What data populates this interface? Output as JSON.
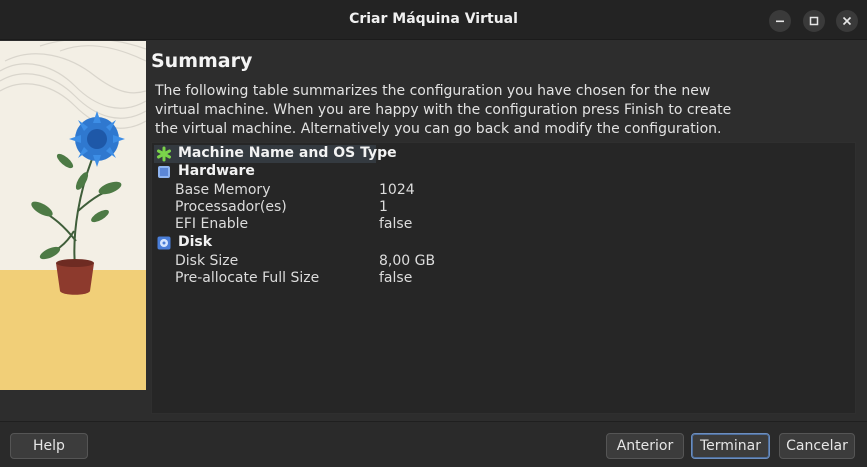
{
  "window": {
    "title": "Criar Máquina Virtual",
    "controls": [
      "minimize-icon",
      "maximize-icon",
      "close-icon"
    ]
  },
  "page": {
    "heading": "Summary",
    "description": "The following table summarizes the configuration you have chosen for the new virtual machine. When you are happy with the configuration press Finish to create the virtual machine. Alternatively you can go back and modify the configuration."
  },
  "summary": {
    "groups": [
      {
        "label": "Machine Name and OS Type",
        "icon": "green-star-icon",
        "rows": []
      },
      {
        "label": "Hardware",
        "icon": "chip-icon",
        "rows": [
          {
            "key": "Base Memory",
            "value": "1024"
          },
          {
            "key": "Processador(es)",
            "value": "1"
          },
          {
            "key": "EFI Enable",
            "value": "false"
          }
        ]
      },
      {
        "label": "Disk",
        "icon": "disk-icon",
        "rows": [
          {
            "key": "Disk Size",
            "value": "8,00 GB"
          },
          {
            "key": "Pre-allocate Full Size",
            "value": "false"
          }
        ]
      }
    ]
  },
  "buttons": {
    "help": "Help",
    "back": "Anterior",
    "finish": "Terminar",
    "cancel": "Cancelar"
  },
  "colors": {
    "background": "#2d2d2d",
    "table_background": "#262626",
    "selection": "#343a40",
    "accent_green": "#7bd44a",
    "accent_blue": "#4a7ed8"
  }
}
